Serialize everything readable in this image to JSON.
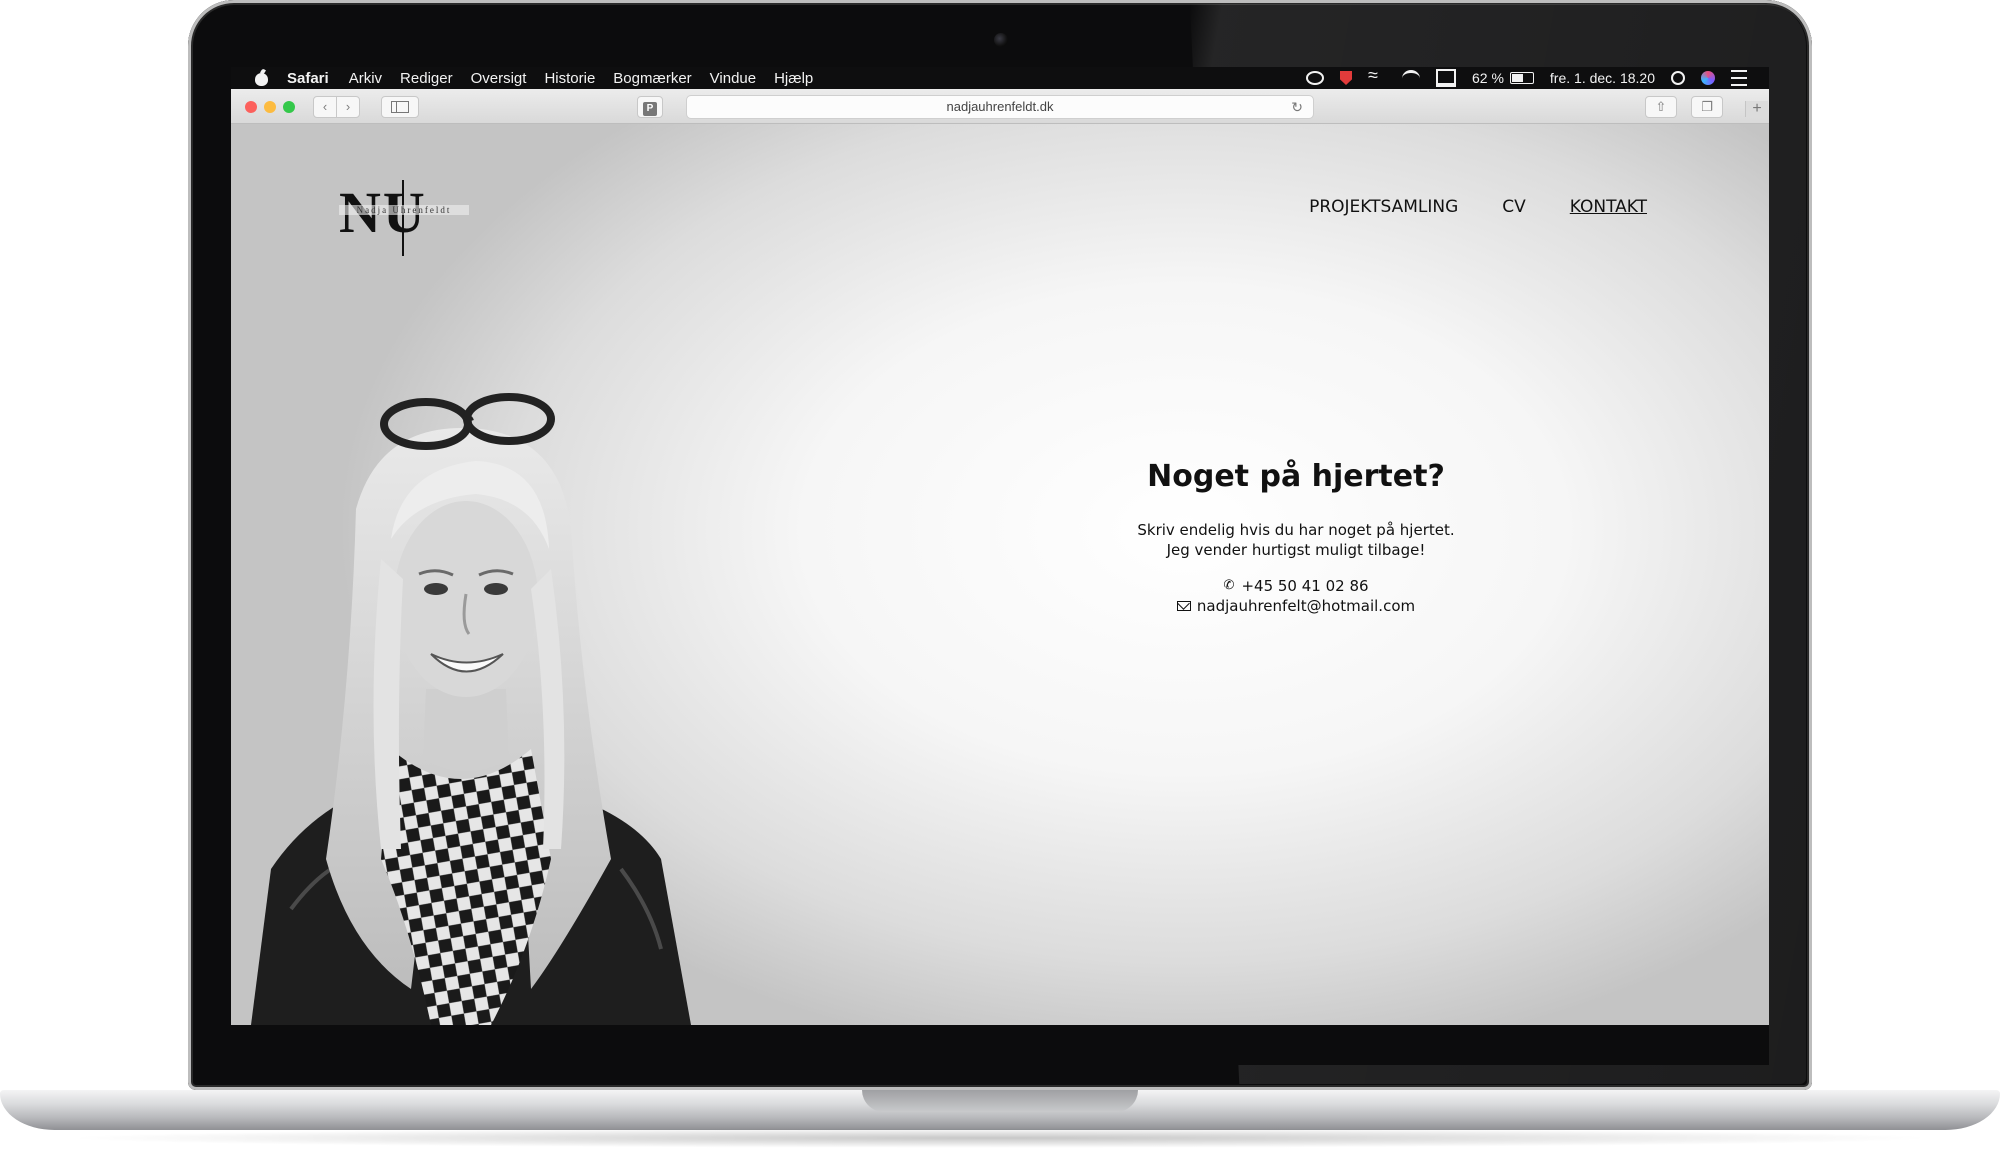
{
  "menubar": {
    "app_name": "Safari",
    "items": [
      "Arkiv",
      "Rediger",
      "Oversigt",
      "Historie",
      "Bogmærker",
      "Vindue",
      "Hjælp"
    ],
    "battery_percent_label": "62 %",
    "battery_level": 0.62,
    "datetime": "fre. 1. dec.  18.20"
  },
  "browser": {
    "url": "nadjauhrenfeldt.dk",
    "pocket_label": "P",
    "new_tab_label": "+"
  },
  "site": {
    "logo_letters": "NU",
    "logo_script": "Nadja Uhrenfeldt",
    "nav": [
      "PROJEKTSAMLING",
      "CV",
      "KONTAKT"
    ],
    "active_nav": "KONTAKT",
    "heading": "Noget på hjertet?",
    "line1": "Skriv endelig hvis du har noget på hjertet.",
    "line2": "Jeg vender hurtigst muligt tilbage!",
    "phone": "+45 50 41 02 86",
    "email": "nadjauhrenfelt@hotmail.com"
  }
}
